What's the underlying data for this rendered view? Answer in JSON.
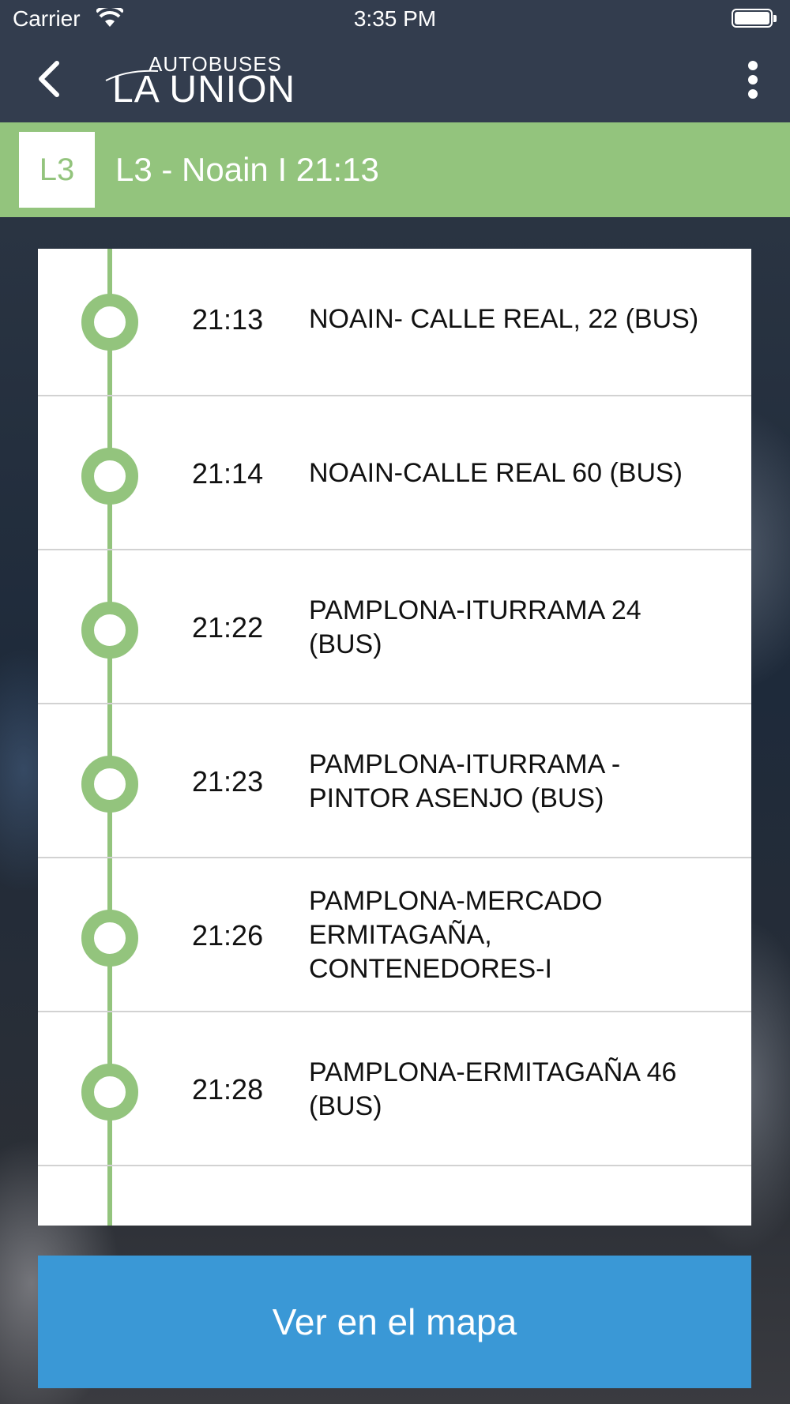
{
  "status_bar": {
    "carrier": "Carrier",
    "time": "3:35 PM"
  },
  "nav": {
    "logo_top": "AUTOBUSES",
    "logo_bottom": "LA UNION"
  },
  "route": {
    "badge": "L3",
    "title": "L3 - Noain I 21:13",
    "accent_color": "#93c47d"
  },
  "stops": [
    {
      "time": "21:13",
      "name": "NOAIN- CALLE REAL, 22 (BUS)"
    },
    {
      "time": "21:14",
      "name": "NOAIN-CALLE REAL 60 (BUS)"
    },
    {
      "time": "21:22",
      "name": "PAMPLONA-ITURRAMA 24 (BUS)"
    },
    {
      "time": "21:23",
      "name": "PAMPLONA-ITURRAMA - PINTOR ASENJO (BUS)"
    },
    {
      "time": "21:26",
      "name": "PAMPLONA-MERCADO ERMITAGAÑA, CONTENEDORES-I"
    },
    {
      "time": "21:28",
      "name": "PAMPLONA-ERMITAGAÑA 46 (BUS)"
    }
  ],
  "map_button": {
    "label": "Ver en el mapa",
    "color": "#3a98d6"
  }
}
